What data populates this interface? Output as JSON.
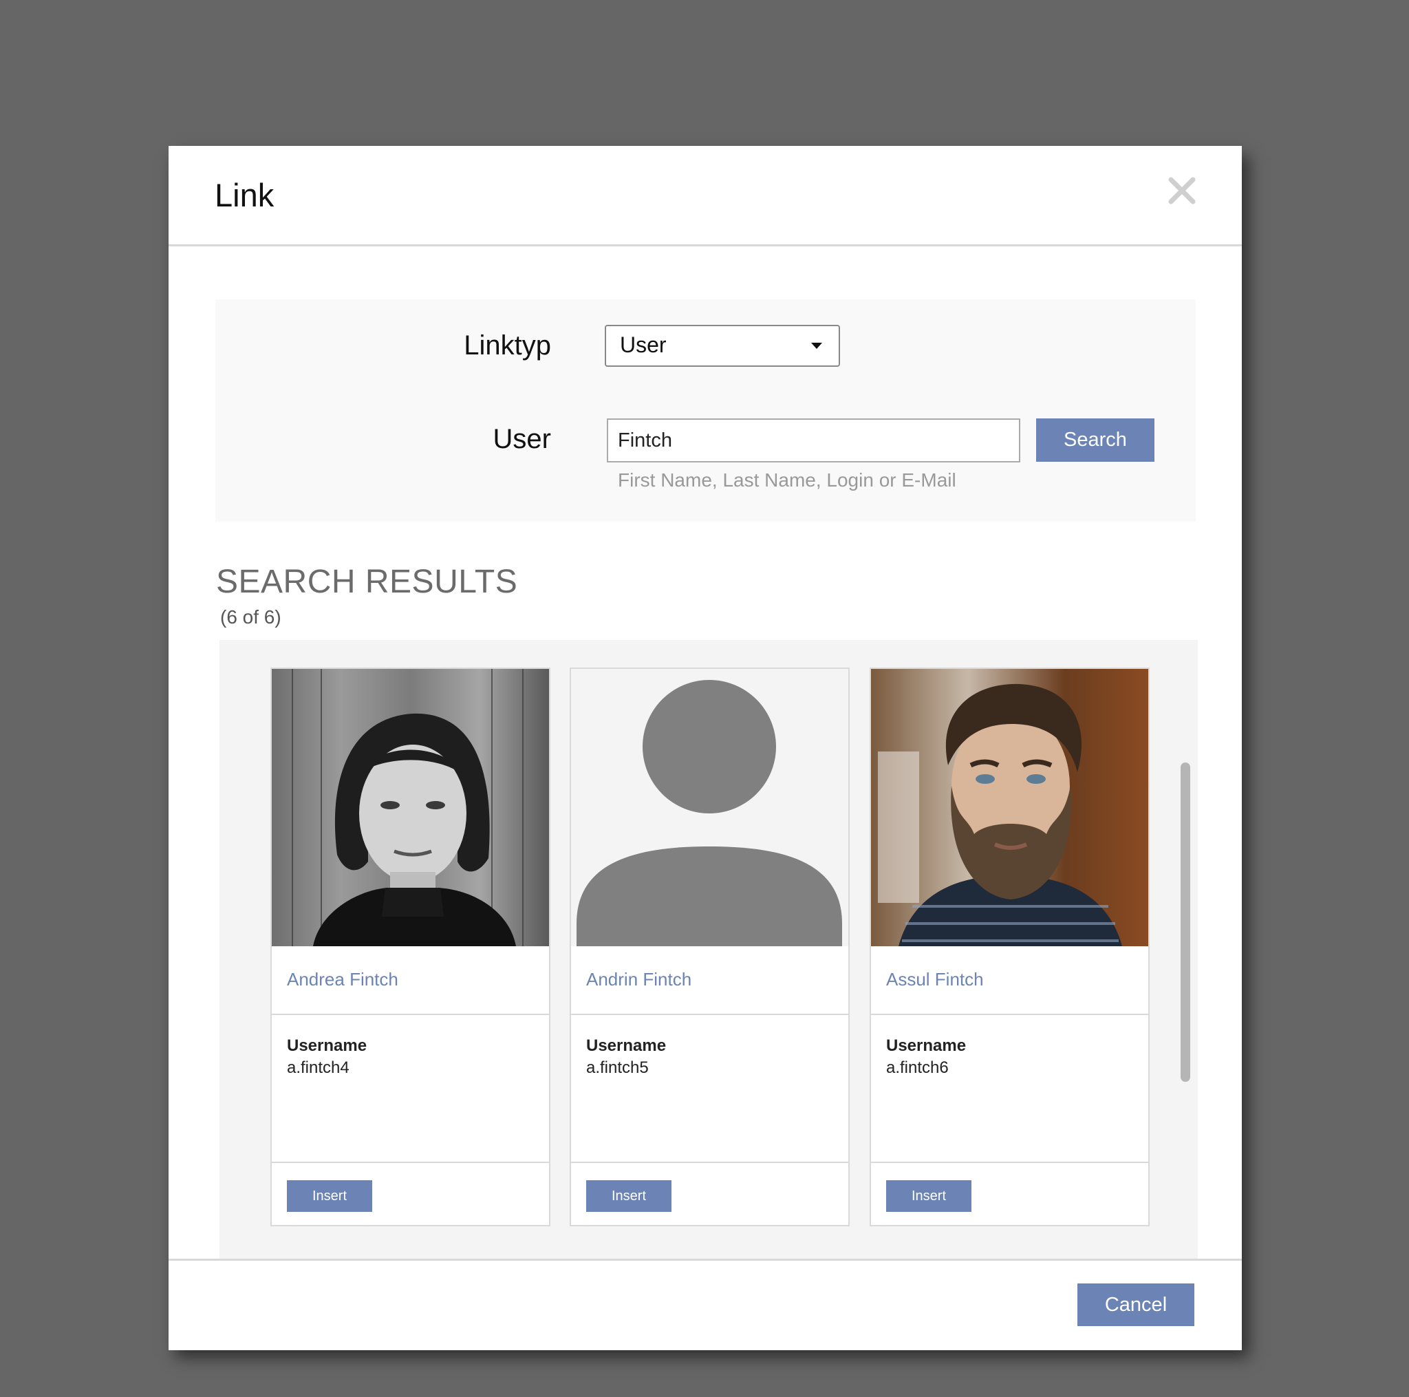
{
  "dialog": {
    "title": "Link",
    "close_icon": "close-icon"
  },
  "form": {
    "linktype_label": "Linktyp",
    "linktype_value": "User",
    "user_label": "User",
    "user_value": "Fintch",
    "search_label": "Search",
    "hint": "First Name, Last Name, Login or E-Mail"
  },
  "results": {
    "title": "SEARCH RESULTS",
    "count": "(6 of 6)",
    "cards": [
      {
        "name": "Andrea Fintch",
        "field_label": "Username",
        "username": "a.fintch4",
        "insert_label": "Insert",
        "photo": "portrait-photo-woman"
      },
      {
        "name": "Andrin Fintch",
        "field_label": "Username",
        "username": "a.fintch5",
        "insert_label": "Insert",
        "photo": "avatar-placeholder-icon"
      },
      {
        "name": "Assul Fintch",
        "field_label": "Username",
        "username": "a.fintch6",
        "insert_label": "Insert",
        "photo": "portrait-photo-bearded-man"
      }
    ]
  },
  "footer": {
    "cancel_label": "Cancel"
  },
  "colors": {
    "backdrop": "#666666",
    "accent": "#6b84b5",
    "link_text": "#6b84b5"
  }
}
